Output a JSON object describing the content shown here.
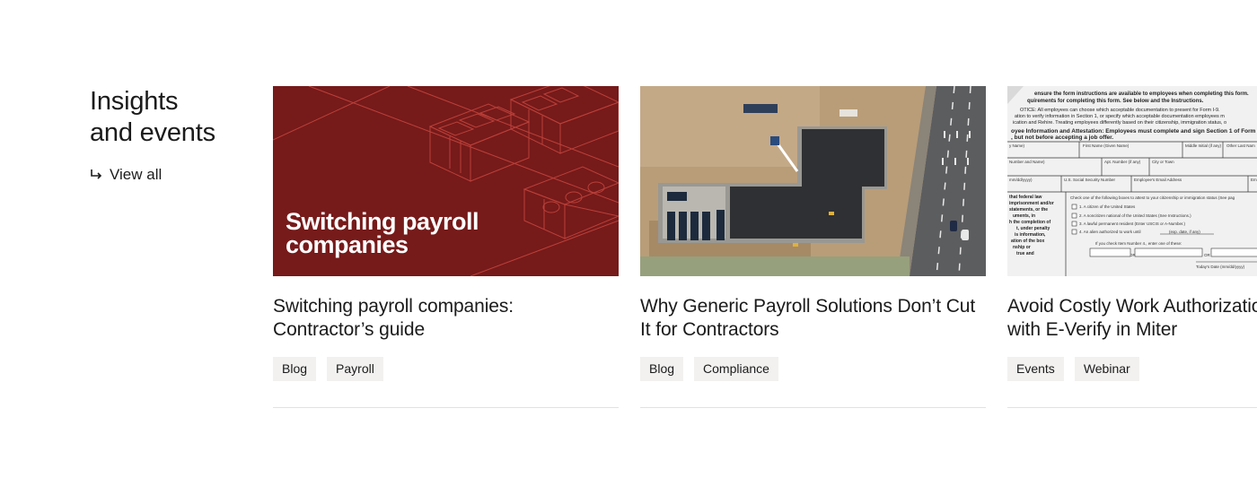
{
  "section": {
    "title_line1": "Insights",
    "title_line2": "and events",
    "view_all": "View all"
  },
  "cards": [
    {
      "image_text_line1": "Switching payroll",
      "image_text_line2": "companies",
      "title": "Switching payroll companies: Contractor’s guide",
      "tags": [
        "Blog",
        "Payroll"
      ]
    },
    {
      "title": "Why Generic Payroll Solutions Don’t Cut It for Contractors",
      "tags": [
        "Blog",
        "Compliance"
      ]
    },
    {
      "title": "Avoid Costly Work Authorization Mistakes with E-Verify in Miter",
      "tags": [
        "Events",
        "Webinar"
      ],
      "form_lines": [
        "ensure the form instructions are available to employees when completing this form.",
        "quirements for completing this form. See below and the Instructions.",
        "OTICE: All employees can choose which acceptable documentation to present for Form I-9.",
        "ation to verify information in Section 1, or specify which acceptable documentation employees m",
        "ication and Rehire. Treating employees differently based on their citizenship, immigration status, o",
        "oyee Information and Attestation: Employees must complete and sign Section 1 of Form",
        ", but not before accepting a job offer.",
        "y Name)",
        "First Name (Given Name)",
        "Middle Initial (if any)",
        "Other Last Nam",
        "Number and Name)",
        "Apt. Number (if any)",
        "City or Town",
        "mm/dd/yyyy)",
        "U.S. Social Security Number",
        "Employee's Email Address",
        "Em",
        "Check one of the following boxes to attest to your citizenship or immigration status (See pag",
        "1. A citizen of the United States",
        "2. A noncitizen national of the United States (See Instructions.)",
        "3. A lawful permanent resident (Enter USCIS or A-Number.)",
        "4. An alien authorized to work until",
        "(exp. date, if any)",
        "If you check Item Number 4., enter one of these:",
        "USCIS A-Number",
        "OR",
        "Form I-94 Admission Number",
        "OR",
        "Foreign Passport N",
        "Today's Date (mm/dd/yyyy)",
        "that federal law",
        "imprisonment and/or",
        "statements, or the",
        "uments, in",
        "h the completion of",
        "t, under penalty",
        "is information,",
        "ation of the box",
        "nship or",
        "true and"
      ]
    }
  ],
  "colors": {
    "red_card_bg": "#761a1a",
    "tag_bg": "#f2f1f0",
    "text": "#1b1b1b"
  },
  "icons": {
    "view_all_arrow": "return-arrow-icon"
  }
}
